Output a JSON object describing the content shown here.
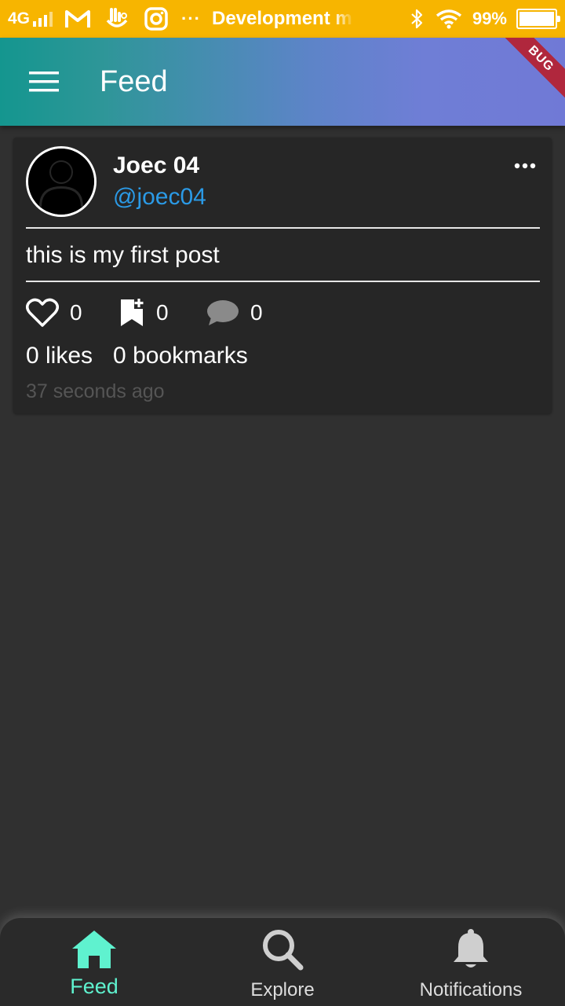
{
  "status_bar": {
    "network": "4G",
    "notice_text": "Development m",
    "more_indicator": "···",
    "battery_percent": "99%",
    "battery_level": 0.99,
    "icons": [
      "gmail-icon",
      "touch-icon",
      "instagram-icon",
      "bluetooth-icon",
      "wifi-icon",
      "battery-icon"
    ]
  },
  "app_bar": {
    "title": "Feed",
    "menu_icon": "hamburger-menu-icon",
    "debug_banner": "BUG",
    "gradient_colors": [
      "#14968f",
      "#7079d6"
    ]
  },
  "post": {
    "author_name": "Joec 04",
    "author_handle": "@joec04",
    "text": "this is my first post",
    "like_count": "0",
    "bookmark_count": "0",
    "comment_count": "0",
    "likes_label": "0 likes",
    "bookmarks_label": "0 bookmarks",
    "timestamp": "37 seconds ago",
    "handle_color": "#2b9ae6"
  },
  "bottom_nav": {
    "items": [
      {
        "label": "Feed",
        "icon": "home-icon",
        "active": true
      },
      {
        "label": "Explore",
        "icon": "search-icon",
        "active": false
      },
      {
        "label": "Notifications",
        "icon": "bell-icon",
        "active": false
      }
    ],
    "active_color": "#5ff2cf"
  }
}
